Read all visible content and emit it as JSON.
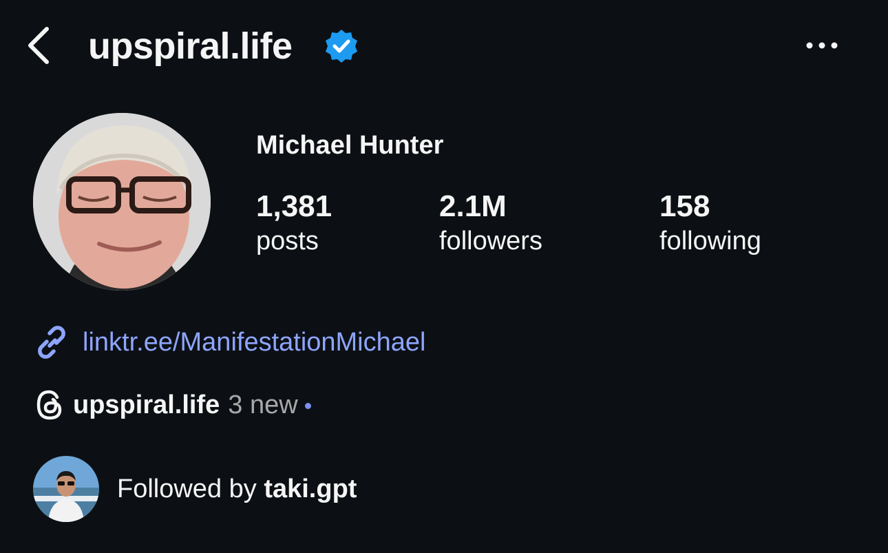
{
  "header": {
    "username": "upspiral.life",
    "verified": true,
    "icons": {
      "back": "chevron-left-icon",
      "verified": "verified-badge-icon",
      "more": "more-horizontal-icon"
    }
  },
  "profile": {
    "display_name": "Michael Hunter",
    "stats": {
      "posts": {
        "value": "1,381",
        "label": "posts"
      },
      "followers": {
        "value": "2.1M",
        "label": "followers"
      },
      "following": {
        "value": "158",
        "label": "following"
      }
    }
  },
  "link": {
    "text": "linktr.ee/ManifestationMichael",
    "icon": "link-icon"
  },
  "threads": {
    "name": "upspiral.life",
    "new_text": "3 new",
    "icon": "threads-icon"
  },
  "followed_by": {
    "prefix": "Followed by",
    "user": "taki.gpt"
  },
  "colors": {
    "background": "#0c1014",
    "text": "#f5f5f5",
    "link": "#8ea5ff",
    "verified": "#1d9bf0",
    "muted": "#a8a8a8",
    "new_dot": "#7e8ff5"
  }
}
